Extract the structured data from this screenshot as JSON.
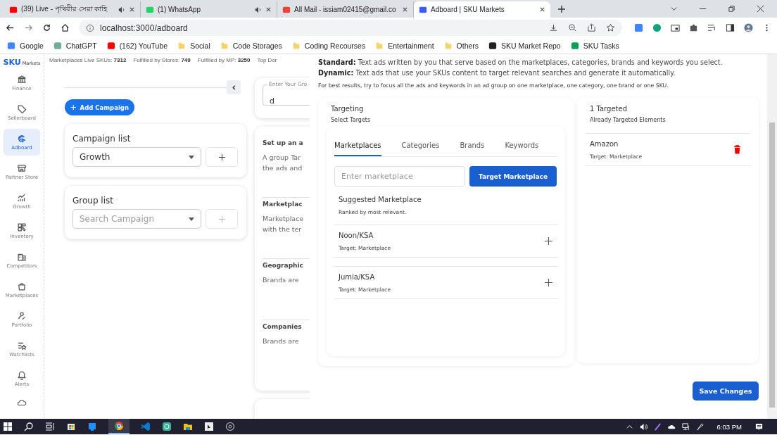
{
  "browser": {
    "tabs": [
      {
        "title": "(39) Live - পৃথিবীর সেরা কাহি",
        "selected": false,
        "audio": true
      },
      {
        "title": "(1) WhatsApp",
        "selected": false,
        "audio": true
      },
      {
        "title": "All Mail - issiam02415@gmail.co",
        "selected": false,
        "audio": false
      },
      {
        "title": "Adboard | SKU Markets",
        "selected": true,
        "audio": false
      }
    ],
    "url": "localhost:3000/adboard",
    "bookmarks": [
      {
        "label": "Google",
        "kind": "site"
      },
      {
        "label": "ChatGPT",
        "kind": "site"
      },
      {
        "label": "(162) YouTube",
        "kind": "site"
      },
      {
        "label": "Social",
        "kind": "folder"
      },
      {
        "label": "Code Storages",
        "kind": "folder"
      },
      {
        "label": "Coding Recourses",
        "kind": "folder"
      },
      {
        "label": "Entertainment",
        "kind": "folder"
      },
      {
        "label": "Others",
        "kind": "folder"
      },
      {
        "label": "SKU Market Repo",
        "kind": "site"
      },
      {
        "label": "SKU Tasks",
        "kind": "site"
      }
    ]
  },
  "sidebar": {
    "logo": {
      "main": "SKU",
      "sub": "Markets"
    },
    "items": [
      {
        "label": "Finance",
        "selected": false
      },
      {
        "label": "Sellerboard",
        "selected": false
      },
      {
        "label": "Adboard",
        "selected": true
      },
      {
        "label": "Partner Store",
        "selected": false
      },
      {
        "label": "Growth",
        "selected": false
      },
      {
        "label": "Inventory",
        "selected": false
      },
      {
        "label": "Competitors",
        "selected": false
      },
      {
        "label": "Marketplaces",
        "selected": false
      },
      {
        "label": "Portfolio",
        "selected": false
      },
      {
        "label": "Watchlists",
        "selected": false
      },
      {
        "label": "Alerts",
        "selected": false
      }
    ]
  },
  "stats": [
    "Marketplaces Live SKUs: **7312**",
    "Fulfilled by Stores: **749**",
    "Fulfilled by MP: **3250**",
    "Top Dor"
  ],
  "campaign_panel": {
    "add_button": "Add Campaign",
    "lists": [
      {
        "title": "Campaign list",
        "value": "Growth",
        "add_disabled": false
      },
      {
        "title": "Group list",
        "placeholder": "Search Campaign",
        "add_disabled": true
      }
    ]
  },
  "group_form": {
    "name_field": {
      "label": "Enter Your Gro",
      "value": "d"
    },
    "sections": [
      {
        "title": "Set up an a",
        "lines": [
          "A group Tar",
          "the ads and"
        ]
      },
      {
        "title": "Marketplac",
        "lines": [
          "Marketplace",
          "with the ter"
        ]
      },
      {
        "title": "Geographic",
        "lines": [
          "Brands are"
        ]
      },
      {
        "title": "Companies",
        "lines": [
          "Brands are"
        ]
      }
    ]
  },
  "drawer": {
    "intro": [
      "**Standard:** Text ads written by you that serve based on the marketplaces, categories, brands and keywords you select.",
      "**Dynamic:** Text ads that use your SKUs content to target relevant searches and generate it automatically."
    ],
    "note": "For best results, try to focus all the ads and keywords in an ad group on one marketplace, one category, one brand or one SKU.",
    "targeting": {
      "title": "Targeting",
      "subtitle": "Select Targets",
      "tabs": [
        {
          "label": "Marketplaces",
          "selected": true
        },
        {
          "label": "Categories",
          "selected": false
        },
        {
          "label": "Brands",
          "selected": false
        },
        {
          "label": "Keywords",
          "selected": false
        }
      ],
      "input": {
        "placeholder": "Enter marketplace"
      },
      "target_button": "Target Marketplace",
      "suggestions_title": "Suggested Marketplace",
      "suggestions_subtitle": "Ranked by most relevant.",
      "suggestions": [
        {
          "name": "Noon/KSA",
          "target": "Target: Marketplace"
        },
        {
          "name": "Jumia/KSA",
          "target": "Target: Marketplace"
        }
      ]
    },
    "targeted": {
      "title": "1 Targeted",
      "subtitle": "Already Targeted Elements",
      "items": [
        {
          "name": "Amazon",
          "target": "Target: Marketplace"
        }
      ]
    },
    "save_button": "Save Changes"
  },
  "taskbar": {
    "time": "6:03 PM"
  }
}
